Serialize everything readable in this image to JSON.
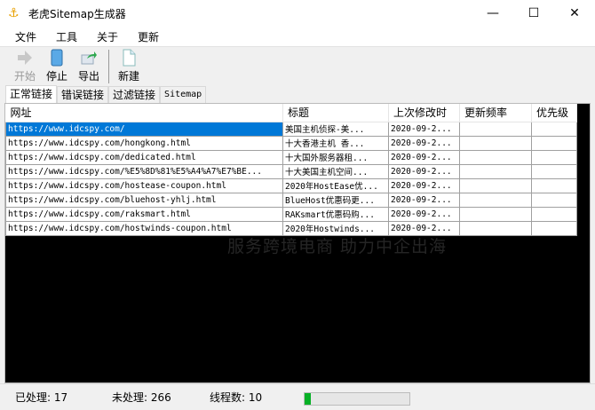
{
  "window": {
    "title": "老虎Sitemap生成器",
    "minimize": "—",
    "maximize": "☐",
    "close": "✕"
  },
  "menu": [
    "文件",
    "工具",
    "关于",
    "更新"
  ],
  "toolbar": {
    "start": "开始",
    "stop": "停止",
    "export": "导出",
    "new": "新建"
  },
  "tabs": [
    "正常链接",
    "错误链接",
    "过滤链接",
    "Sitemap"
  ],
  "table": {
    "headers": [
      "网址",
      "标题",
      "上次修改时",
      "更新频率",
      "优先级"
    ],
    "rows": [
      [
        "https://www.idcspy.com/",
        "美国主机侦探-美...",
        "2020-09-2...",
        "",
        ""
      ],
      [
        "https://www.idcspy.com/hongkong.html",
        "十大香港主机 香...",
        "2020-09-2...",
        "",
        ""
      ],
      [
        "https://www.idcspy.com/dedicated.html",
        "十大国外服务器租...",
        "2020-09-2...",
        "",
        ""
      ],
      [
        "https://www.idcspy.com/%E5%8D%81%E5%A4%A7%E7%BE...",
        "十大美国主机空间...",
        "2020-09-2...",
        "",
        ""
      ],
      [
        "https://www.idcspy.com/hostease-coupon.html",
        "2020年HostEase优...",
        "2020-09-2...",
        "",
        ""
      ],
      [
        "https://www.idcspy.com/bluehost-yhlj.html",
        "BlueHost优惠码更...",
        "2020-09-2...",
        "",
        ""
      ],
      [
        "https://www.idcspy.com/raksmart.html",
        "RAKsmart优惠码购...",
        "2020-09-2...",
        "",
        ""
      ],
      [
        "https://www.idcspy.com/hostwinds-coupon.html",
        "2020年Hostwinds...",
        "2020-09-2...",
        "",
        ""
      ]
    ]
  },
  "watermark": "服务跨境电商 助力中企出海",
  "status": {
    "processed": "已处理: 17",
    "unprocessed": "未处理: 266",
    "threads": "线程数: 10",
    "progress_percent": 6
  }
}
